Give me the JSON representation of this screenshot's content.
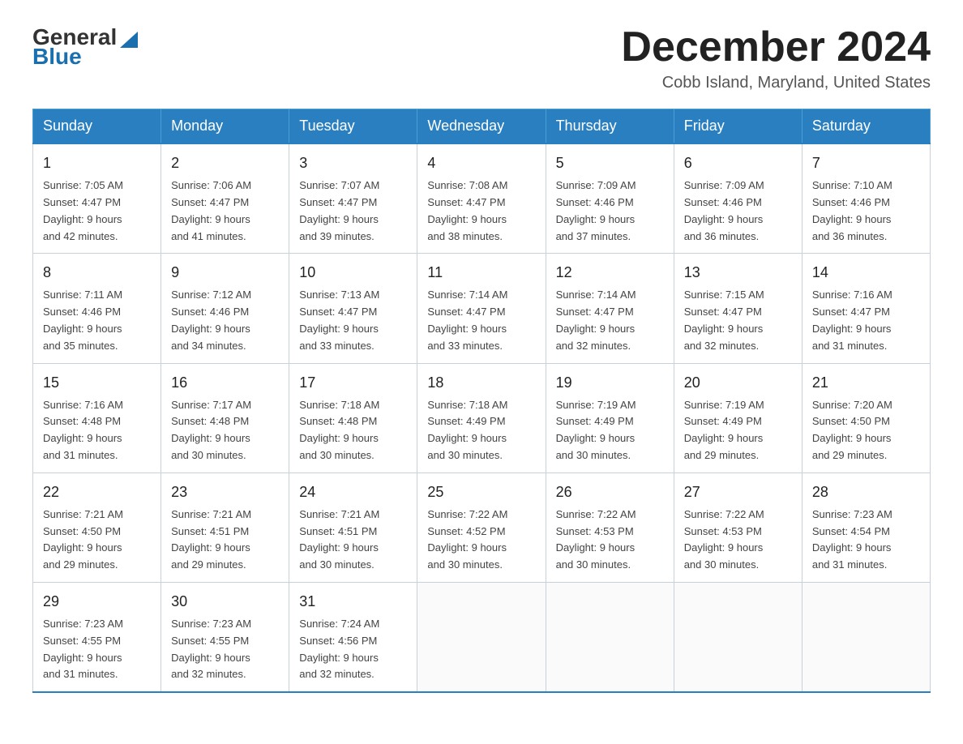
{
  "header": {
    "logo_general": "General",
    "logo_blue": "Blue",
    "title": "December 2024",
    "subtitle": "Cobb Island, Maryland, United States"
  },
  "days_of_week": [
    "Sunday",
    "Monday",
    "Tuesday",
    "Wednesday",
    "Thursday",
    "Friday",
    "Saturday"
  ],
  "weeks": [
    [
      {
        "day": "1",
        "sunrise": "7:05 AM",
        "sunset": "4:47 PM",
        "daylight": "9 hours and 42 minutes."
      },
      {
        "day": "2",
        "sunrise": "7:06 AM",
        "sunset": "4:47 PM",
        "daylight": "9 hours and 41 minutes."
      },
      {
        "day": "3",
        "sunrise": "7:07 AM",
        "sunset": "4:47 PM",
        "daylight": "9 hours and 39 minutes."
      },
      {
        "day": "4",
        "sunrise": "7:08 AM",
        "sunset": "4:47 PM",
        "daylight": "9 hours and 38 minutes."
      },
      {
        "day": "5",
        "sunrise": "7:09 AM",
        "sunset": "4:46 PM",
        "daylight": "9 hours and 37 minutes."
      },
      {
        "day": "6",
        "sunrise": "7:09 AM",
        "sunset": "4:46 PM",
        "daylight": "9 hours and 36 minutes."
      },
      {
        "day": "7",
        "sunrise": "7:10 AM",
        "sunset": "4:46 PM",
        "daylight": "9 hours and 36 minutes."
      }
    ],
    [
      {
        "day": "8",
        "sunrise": "7:11 AM",
        "sunset": "4:46 PM",
        "daylight": "9 hours and 35 minutes."
      },
      {
        "day": "9",
        "sunrise": "7:12 AM",
        "sunset": "4:46 PM",
        "daylight": "9 hours and 34 minutes."
      },
      {
        "day": "10",
        "sunrise": "7:13 AM",
        "sunset": "4:47 PM",
        "daylight": "9 hours and 33 minutes."
      },
      {
        "day": "11",
        "sunrise": "7:14 AM",
        "sunset": "4:47 PM",
        "daylight": "9 hours and 33 minutes."
      },
      {
        "day": "12",
        "sunrise": "7:14 AM",
        "sunset": "4:47 PM",
        "daylight": "9 hours and 32 minutes."
      },
      {
        "day": "13",
        "sunrise": "7:15 AM",
        "sunset": "4:47 PM",
        "daylight": "9 hours and 32 minutes."
      },
      {
        "day": "14",
        "sunrise": "7:16 AM",
        "sunset": "4:47 PM",
        "daylight": "9 hours and 31 minutes."
      }
    ],
    [
      {
        "day": "15",
        "sunrise": "7:16 AM",
        "sunset": "4:48 PM",
        "daylight": "9 hours and 31 minutes."
      },
      {
        "day": "16",
        "sunrise": "7:17 AM",
        "sunset": "4:48 PM",
        "daylight": "9 hours and 30 minutes."
      },
      {
        "day": "17",
        "sunrise": "7:18 AM",
        "sunset": "4:48 PM",
        "daylight": "9 hours and 30 minutes."
      },
      {
        "day": "18",
        "sunrise": "7:18 AM",
        "sunset": "4:49 PM",
        "daylight": "9 hours and 30 minutes."
      },
      {
        "day": "19",
        "sunrise": "7:19 AM",
        "sunset": "4:49 PM",
        "daylight": "9 hours and 30 minutes."
      },
      {
        "day": "20",
        "sunrise": "7:19 AM",
        "sunset": "4:49 PM",
        "daylight": "9 hours and 29 minutes."
      },
      {
        "day": "21",
        "sunrise": "7:20 AM",
        "sunset": "4:50 PM",
        "daylight": "9 hours and 29 minutes."
      }
    ],
    [
      {
        "day": "22",
        "sunrise": "7:21 AM",
        "sunset": "4:50 PM",
        "daylight": "9 hours and 29 minutes."
      },
      {
        "day": "23",
        "sunrise": "7:21 AM",
        "sunset": "4:51 PM",
        "daylight": "9 hours and 29 minutes."
      },
      {
        "day": "24",
        "sunrise": "7:21 AM",
        "sunset": "4:51 PM",
        "daylight": "9 hours and 30 minutes."
      },
      {
        "day": "25",
        "sunrise": "7:22 AM",
        "sunset": "4:52 PM",
        "daylight": "9 hours and 30 minutes."
      },
      {
        "day": "26",
        "sunrise": "7:22 AM",
        "sunset": "4:53 PM",
        "daylight": "9 hours and 30 minutes."
      },
      {
        "day": "27",
        "sunrise": "7:22 AM",
        "sunset": "4:53 PM",
        "daylight": "9 hours and 30 minutes."
      },
      {
        "day": "28",
        "sunrise": "7:23 AM",
        "sunset": "4:54 PM",
        "daylight": "9 hours and 31 minutes."
      }
    ],
    [
      {
        "day": "29",
        "sunrise": "7:23 AM",
        "sunset": "4:55 PM",
        "daylight": "9 hours and 31 minutes."
      },
      {
        "day": "30",
        "sunrise": "7:23 AM",
        "sunset": "4:55 PM",
        "daylight": "9 hours and 32 minutes."
      },
      {
        "day": "31",
        "sunrise": "7:24 AM",
        "sunset": "4:56 PM",
        "daylight": "9 hours and 32 minutes."
      },
      null,
      null,
      null,
      null
    ]
  ],
  "labels": {
    "sunrise": "Sunrise:",
    "sunset": "Sunset:",
    "daylight": "Daylight:"
  }
}
